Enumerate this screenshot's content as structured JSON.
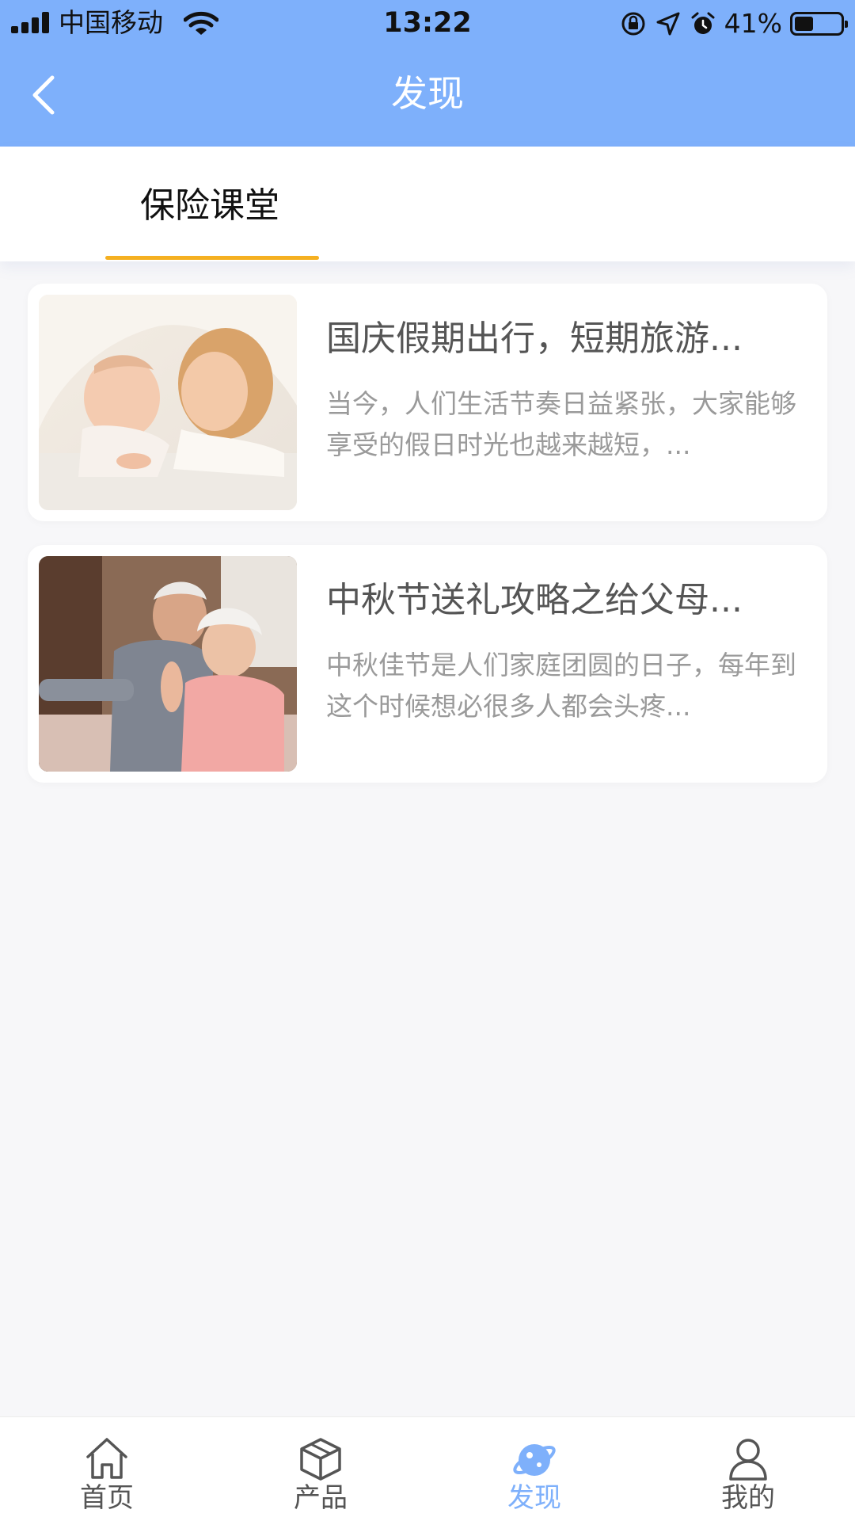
{
  "status_bar": {
    "carrier": "中国移动",
    "time": "13:22",
    "battery_percent": "41%",
    "battery_level": 0.41
  },
  "header": {
    "title": "发现",
    "back_icon": "chevron-left-icon"
  },
  "tabs": [
    {
      "label": "保险课堂",
      "active": true
    }
  ],
  "articles": [
    {
      "title": "国庆假期出行，短期旅游...",
      "description": "当今，人们生活节奏日益紧张，大家能够享受的假日时光也越来越短，..."
    },
    {
      "title": "中秋节送礼攻略之给父母...",
      "description": "中秋佳节是人们家庭团圆的日子，每年到这个时候想必很多人都会头疼..."
    }
  ],
  "bottom_nav": [
    {
      "label": "首页",
      "icon": "home-icon",
      "active": false
    },
    {
      "label": "产品",
      "icon": "box-icon",
      "active": false
    },
    {
      "label": "发现",
      "icon": "planet-icon",
      "active": true
    },
    {
      "label": "我的",
      "icon": "user-icon",
      "active": false
    }
  ],
  "colors": {
    "header_bg": "#7eb0fb",
    "accent": "#7eb0fb",
    "tab_underline": "#f5b021",
    "page_bg": "#f7f7f9"
  }
}
